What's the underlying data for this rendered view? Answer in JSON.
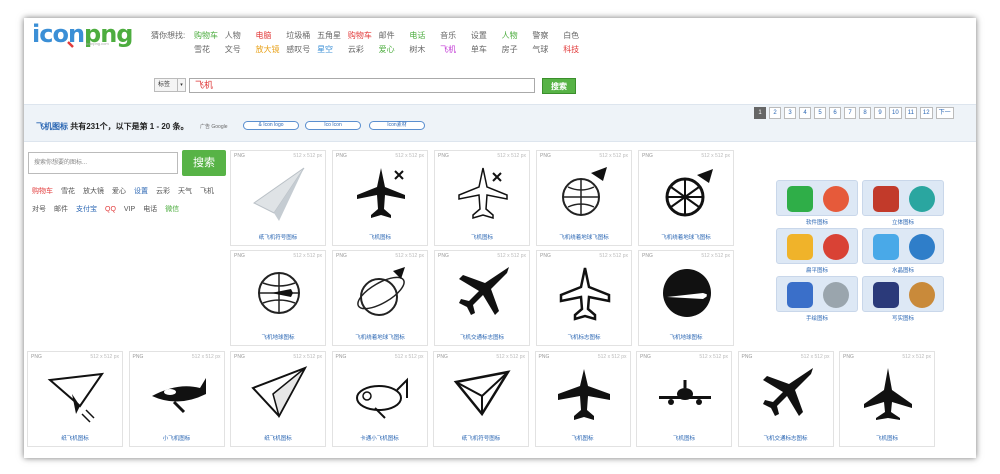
{
  "logo": {
    "text_a": "icon",
    "text_b": "png",
    "sub": "iconpng.com"
  },
  "guess_label": "猜你想找:",
  "keywords_row1": [
    {
      "t": "购物车",
      "c": "#4dad3f"
    },
    {
      "t": "人物",
      "c": "#666"
    },
    {
      "t": "电脑",
      "c": "#e23a3a"
    },
    {
      "t": "垃圾桶",
      "c": "#666"
    },
    {
      "t": "五角星",
      "c": "#666"
    },
    {
      "t": "购物车",
      "c": "#e23a3a"
    },
    {
      "t": "邮件",
      "c": "#666"
    },
    {
      "t": "电话",
      "c": "#4dad3f"
    },
    {
      "t": "音乐",
      "c": "#666"
    },
    {
      "t": "设置",
      "c": "#666"
    },
    {
      "t": "人物",
      "c": "#4dad3f"
    },
    {
      "t": "警察",
      "c": "#666"
    },
    {
      "t": "白色",
      "c": "#666"
    }
  ],
  "keywords_row2": [
    {
      "t": "雪花",
      "c": "#666"
    },
    {
      "t": "文号",
      "c": "#666"
    },
    {
      "t": "放大镜",
      "c": "#e8a21a"
    },
    {
      "t": "感叹号",
      "c": "#666"
    },
    {
      "t": "星空",
      "c": "#3b8fd6"
    },
    {
      "t": "云彩",
      "c": "#666"
    },
    {
      "t": "爱心",
      "c": "#4dad3f"
    },
    {
      "t": "树木",
      "c": "#666"
    },
    {
      "t": "飞机",
      "c": "#c33bd6"
    },
    {
      "t": "单车",
      "c": "#666"
    },
    {
      "t": "房子",
      "c": "#666"
    },
    {
      "t": "气球",
      "c": "#666"
    },
    {
      "t": "科技",
      "c": "#e23a3a"
    }
  ],
  "search": {
    "select_label": "标签",
    "query": "飞机",
    "button": "搜索"
  },
  "results": {
    "title": "飞机图标",
    "summary": "共有231个，以下是第 1 - 20 条。",
    "ads_label": "广告 Google",
    "ad_links": [
      "& Icon logo",
      "Ico Icon",
      "Icon素材"
    ],
    "pages": [
      "1",
      "2",
      "3",
      "4",
      "5",
      "6",
      "7",
      "8",
      "9",
      "10",
      "11",
      "12",
      "下一"
    ]
  },
  "side": {
    "placeholder": "搜索你想要的图标...",
    "button": "搜索",
    "tags_row1": [
      {
        "t": "购物车",
        "c": "#e23a3a"
      },
      {
        "t": "雪花",
        "c": "#555"
      },
      {
        "t": "放大镜",
        "c": "#555"
      },
      {
        "t": "爱心",
        "c": "#555"
      },
      {
        "t": "设置",
        "c": "#2a66b3"
      },
      {
        "t": "云彩",
        "c": "#555"
      },
      {
        "t": "天气",
        "c": "#555"
      },
      {
        "t": "飞机",
        "c": "#555"
      }
    ],
    "tags_row2": [
      {
        "t": "对号",
        "c": "#555"
      },
      {
        "t": "邮件",
        "c": "#555"
      },
      {
        "t": "支付宝",
        "c": "#2a66b3"
      },
      {
        "t": "QQ",
        "c": "#e23a3a"
      },
      {
        "t": "VIP",
        "c": "#555"
      },
      {
        "t": "电话",
        "c": "#555"
      },
      {
        "t": "微信",
        "c": "#4dad3f"
      }
    ]
  },
  "card_meta": {
    "format": "PNG",
    "size": "512 x 512 px"
  },
  "cards_row1": [
    {
      "name": "纸飞机符号图标",
      "icon": "paper-plane-icon"
    },
    {
      "name": "飞机图标",
      "icon": "airplane-x-icon"
    },
    {
      "name": "飞机图标",
      "icon": "airplane-outline-x-icon"
    },
    {
      "name": "飞机绕着地球飞图标",
      "icon": "globe-plane-icon"
    },
    {
      "name": "飞机绕着地球飞图标",
      "icon": "globe-plane-sketch-icon"
    }
  ],
  "cards_row2": [
    {
      "name": "飞机地球图标",
      "icon": "globe-airplane-icon"
    },
    {
      "name": "飞机绕着地球飞图标",
      "icon": "globe-orbit-plane-icon"
    },
    {
      "name": "飞机交通标志图标",
      "icon": "airplane-solid-icon"
    },
    {
      "name": "飞机标志图标",
      "icon": "airplane-outline-icon"
    },
    {
      "name": "飞机地球图标",
      "icon": "circle-plane-icon"
    }
  ],
  "cards_row3": [
    {
      "name": "纸飞机图标",
      "icon": "paper-plane-sketch-icon"
    },
    {
      "name": "小飞机图标",
      "icon": "small-plane-icon"
    },
    {
      "name": "纸飞机图标",
      "icon": "paper-plane-hand-icon"
    },
    {
      "name": "卡通小飞机图标",
      "icon": "cartoon-plane-icon"
    },
    {
      "name": "纸飞机符号图标",
      "icon": "paper-plane-outline-icon"
    },
    {
      "name": "飞机图标",
      "icon": "airplane-top-icon"
    },
    {
      "name": "飞机图标",
      "icon": "airplane-front-icon"
    },
    {
      "name": "飞机交通标志图标",
      "icon": "airplane-traffic-icon"
    },
    {
      "name": "飞机图标",
      "icon": "fighter-jet-icon"
    }
  ],
  "categories": [
    {
      "label": "软件图标"
    },
    {
      "label": "立体图标"
    },
    {
      "label": "扁平图标"
    },
    {
      "label": "水晶图标"
    },
    {
      "label": "手绘图标"
    },
    {
      "label": "写实图标"
    }
  ],
  "colors": {
    "accent_green": "#57b346",
    "link_blue": "#2a66b3",
    "panel_blue": "#dde8f5"
  }
}
